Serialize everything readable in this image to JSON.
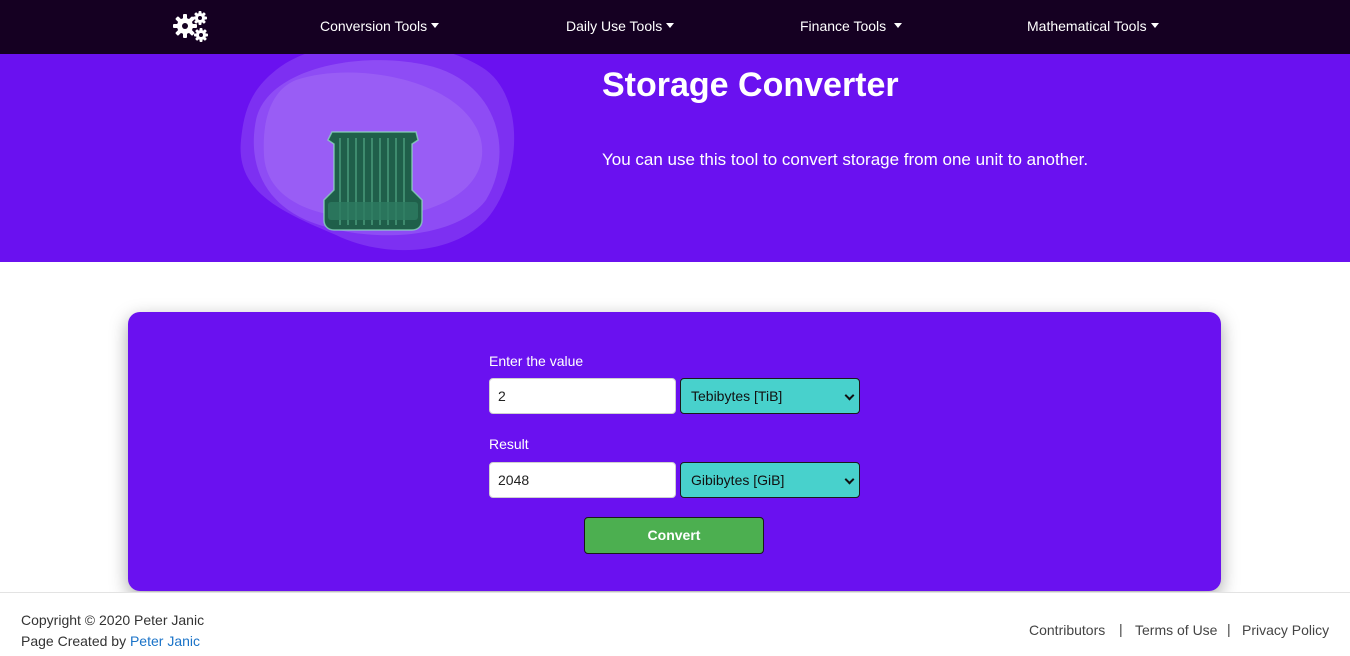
{
  "nav": {
    "logo_icon": "gears-icon",
    "items": [
      {
        "label": "Conversion Tools"
      },
      {
        "label": "Daily Use Tools"
      },
      {
        "label": "Finance Tools"
      },
      {
        "label": "Mathematical Tools"
      }
    ]
  },
  "hero": {
    "title": "Storage Converter",
    "description": "You can use this tool to convert storage from one unit to another.",
    "image_icon": "storage-drive-icon"
  },
  "form": {
    "value_label": "Enter the value",
    "value": "2",
    "from_unit": "Tebibytes [TiB]",
    "result_label": "Result",
    "result": "2048",
    "to_unit": "Gibibytes [GiB]",
    "convert_label": "Convert"
  },
  "footer": {
    "copyright": "Copyright © 2020 Peter Janic",
    "created_prefix": "Page Created by ",
    "author": "Peter Janic",
    "links": [
      {
        "label": "Contributors"
      },
      {
        "label": "Terms of Use"
      },
      {
        "label": "Privacy Policy"
      }
    ],
    "separator": "|"
  },
  "colors": {
    "navbar": "#150022",
    "primary": "#6a11f0",
    "select": "#48d1cc",
    "button": "#4caf50",
    "link": "#1a73c8"
  }
}
